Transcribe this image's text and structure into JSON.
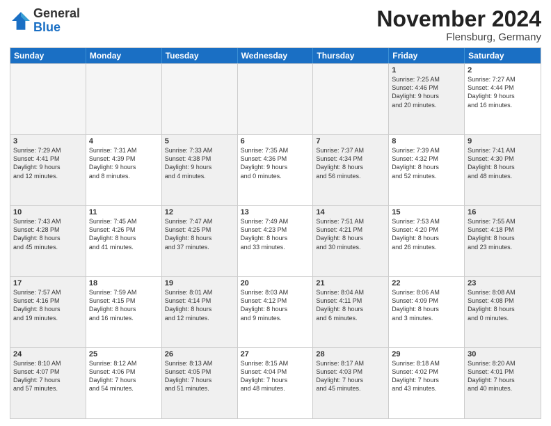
{
  "logo": {
    "general": "General",
    "blue": "Blue"
  },
  "title": "November 2024",
  "location": "Flensburg, Germany",
  "weekdays": [
    "Sunday",
    "Monday",
    "Tuesday",
    "Wednesday",
    "Thursday",
    "Friday",
    "Saturday"
  ],
  "rows": [
    [
      {
        "day": "",
        "info": "",
        "empty": true
      },
      {
        "day": "",
        "info": "",
        "empty": true
      },
      {
        "day": "",
        "info": "",
        "empty": true
      },
      {
        "day": "",
        "info": "",
        "empty": true
      },
      {
        "day": "",
        "info": "",
        "empty": true
      },
      {
        "day": "1",
        "info": "Sunrise: 7:25 AM\nSunset: 4:46 PM\nDaylight: 9 hours\nand 20 minutes.",
        "shaded": true
      },
      {
        "day": "2",
        "info": "Sunrise: 7:27 AM\nSunset: 4:44 PM\nDaylight: 9 hours\nand 16 minutes.",
        "shaded": false
      }
    ],
    [
      {
        "day": "3",
        "info": "Sunrise: 7:29 AM\nSunset: 4:41 PM\nDaylight: 9 hours\nand 12 minutes.",
        "shaded": true
      },
      {
        "day": "4",
        "info": "Sunrise: 7:31 AM\nSunset: 4:39 PM\nDaylight: 9 hours\nand 8 minutes.",
        "shaded": false
      },
      {
        "day": "5",
        "info": "Sunrise: 7:33 AM\nSunset: 4:38 PM\nDaylight: 9 hours\nand 4 minutes.",
        "shaded": true
      },
      {
        "day": "6",
        "info": "Sunrise: 7:35 AM\nSunset: 4:36 PM\nDaylight: 9 hours\nand 0 minutes.",
        "shaded": false
      },
      {
        "day": "7",
        "info": "Sunrise: 7:37 AM\nSunset: 4:34 PM\nDaylight: 8 hours\nand 56 minutes.",
        "shaded": true
      },
      {
        "day": "8",
        "info": "Sunrise: 7:39 AM\nSunset: 4:32 PM\nDaylight: 8 hours\nand 52 minutes.",
        "shaded": false
      },
      {
        "day": "9",
        "info": "Sunrise: 7:41 AM\nSunset: 4:30 PM\nDaylight: 8 hours\nand 48 minutes.",
        "shaded": true
      }
    ],
    [
      {
        "day": "10",
        "info": "Sunrise: 7:43 AM\nSunset: 4:28 PM\nDaylight: 8 hours\nand 45 minutes.",
        "shaded": true
      },
      {
        "day": "11",
        "info": "Sunrise: 7:45 AM\nSunset: 4:26 PM\nDaylight: 8 hours\nand 41 minutes.",
        "shaded": false
      },
      {
        "day": "12",
        "info": "Sunrise: 7:47 AM\nSunset: 4:25 PM\nDaylight: 8 hours\nand 37 minutes.",
        "shaded": true
      },
      {
        "day": "13",
        "info": "Sunrise: 7:49 AM\nSunset: 4:23 PM\nDaylight: 8 hours\nand 33 minutes.",
        "shaded": false
      },
      {
        "day": "14",
        "info": "Sunrise: 7:51 AM\nSunset: 4:21 PM\nDaylight: 8 hours\nand 30 minutes.",
        "shaded": true
      },
      {
        "day": "15",
        "info": "Sunrise: 7:53 AM\nSunset: 4:20 PM\nDaylight: 8 hours\nand 26 minutes.",
        "shaded": false
      },
      {
        "day": "16",
        "info": "Sunrise: 7:55 AM\nSunset: 4:18 PM\nDaylight: 8 hours\nand 23 minutes.",
        "shaded": true
      }
    ],
    [
      {
        "day": "17",
        "info": "Sunrise: 7:57 AM\nSunset: 4:16 PM\nDaylight: 8 hours\nand 19 minutes.",
        "shaded": true
      },
      {
        "day": "18",
        "info": "Sunrise: 7:59 AM\nSunset: 4:15 PM\nDaylight: 8 hours\nand 16 minutes.",
        "shaded": false
      },
      {
        "day": "19",
        "info": "Sunrise: 8:01 AM\nSunset: 4:14 PM\nDaylight: 8 hours\nand 12 minutes.",
        "shaded": true
      },
      {
        "day": "20",
        "info": "Sunrise: 8:03 AM\nSunset: 4:12 PM\nDaylight: 8 hours\nand 9 minutes.",
        "shaded": false
      },
      {
        "day": "21",
        "info": "Sunrise: 8:04 AM\nSunset: 4:11 PM\nDaylight: 8 hours\nand 6 minutes.",
        "shaded": true
      },
      {
        "day": "22",
        "info": "Sunrise: 8:06 AM\nSunset: 4:09 PM\nDaylight: 8 hours\nand 3 minutes.",
        "shaded": false
      },
      {
        "day": "23",
        "info": "Sunrise: 8:08 AM\nSunset: 4:08 PM\nDaylight: 8 hours\nand 0 minutes.",
        "shaded": true
      }
    ],
    [
      {
        "day": "24",
        "info": "Sunrise: 8:10 AM\nSunset: 4:07 PM\nDaylight: 7 hours\nand 57 minutes.",
        "shaded": true
      },
      {
        "day": "25",
        "info": "Sunrise: 8:12 AM\nSunset: 4:06 PM\nDaylight: 7 hours\nand 54 minutes.",
        "shaded": false
      },
      {
        "day": "26",
        "info": "Sunrise: 8:13 AM\nSunset: 4:05 PM\nDaylight: 7 hours\nand 51 minutes.",
        "shaded": true
      },
      {
        "day": "27",
        "info": "Sunrise: 8:15 AM\nSunset: 4:04 PM\nDaylight: 7 hours\nand 48 minutes.",
        "shaded": false
      },
      {
        "day": "28",
        "info": "Sunrise: 8:17 AM\nSunset: 4:03 PM\nDaylight: 7 hours\nand 45 minutes.",
        "shaded": true
      },
      {
        "day": "29",
        "info": "Sunrise: 8:18 AM\nSunset: 4:02 PM\nDaylight: 7 hours\nand 43 minutes.",
        "shaded": false
      },
      {
        "day": "30",
        "info": "Sunrise: 8:20 AM\nSunset: 4:01 PM\nDaylight: 7 hours\nand 40 minutes.",
        "shaded": true
      }
    ]
  ]
}
